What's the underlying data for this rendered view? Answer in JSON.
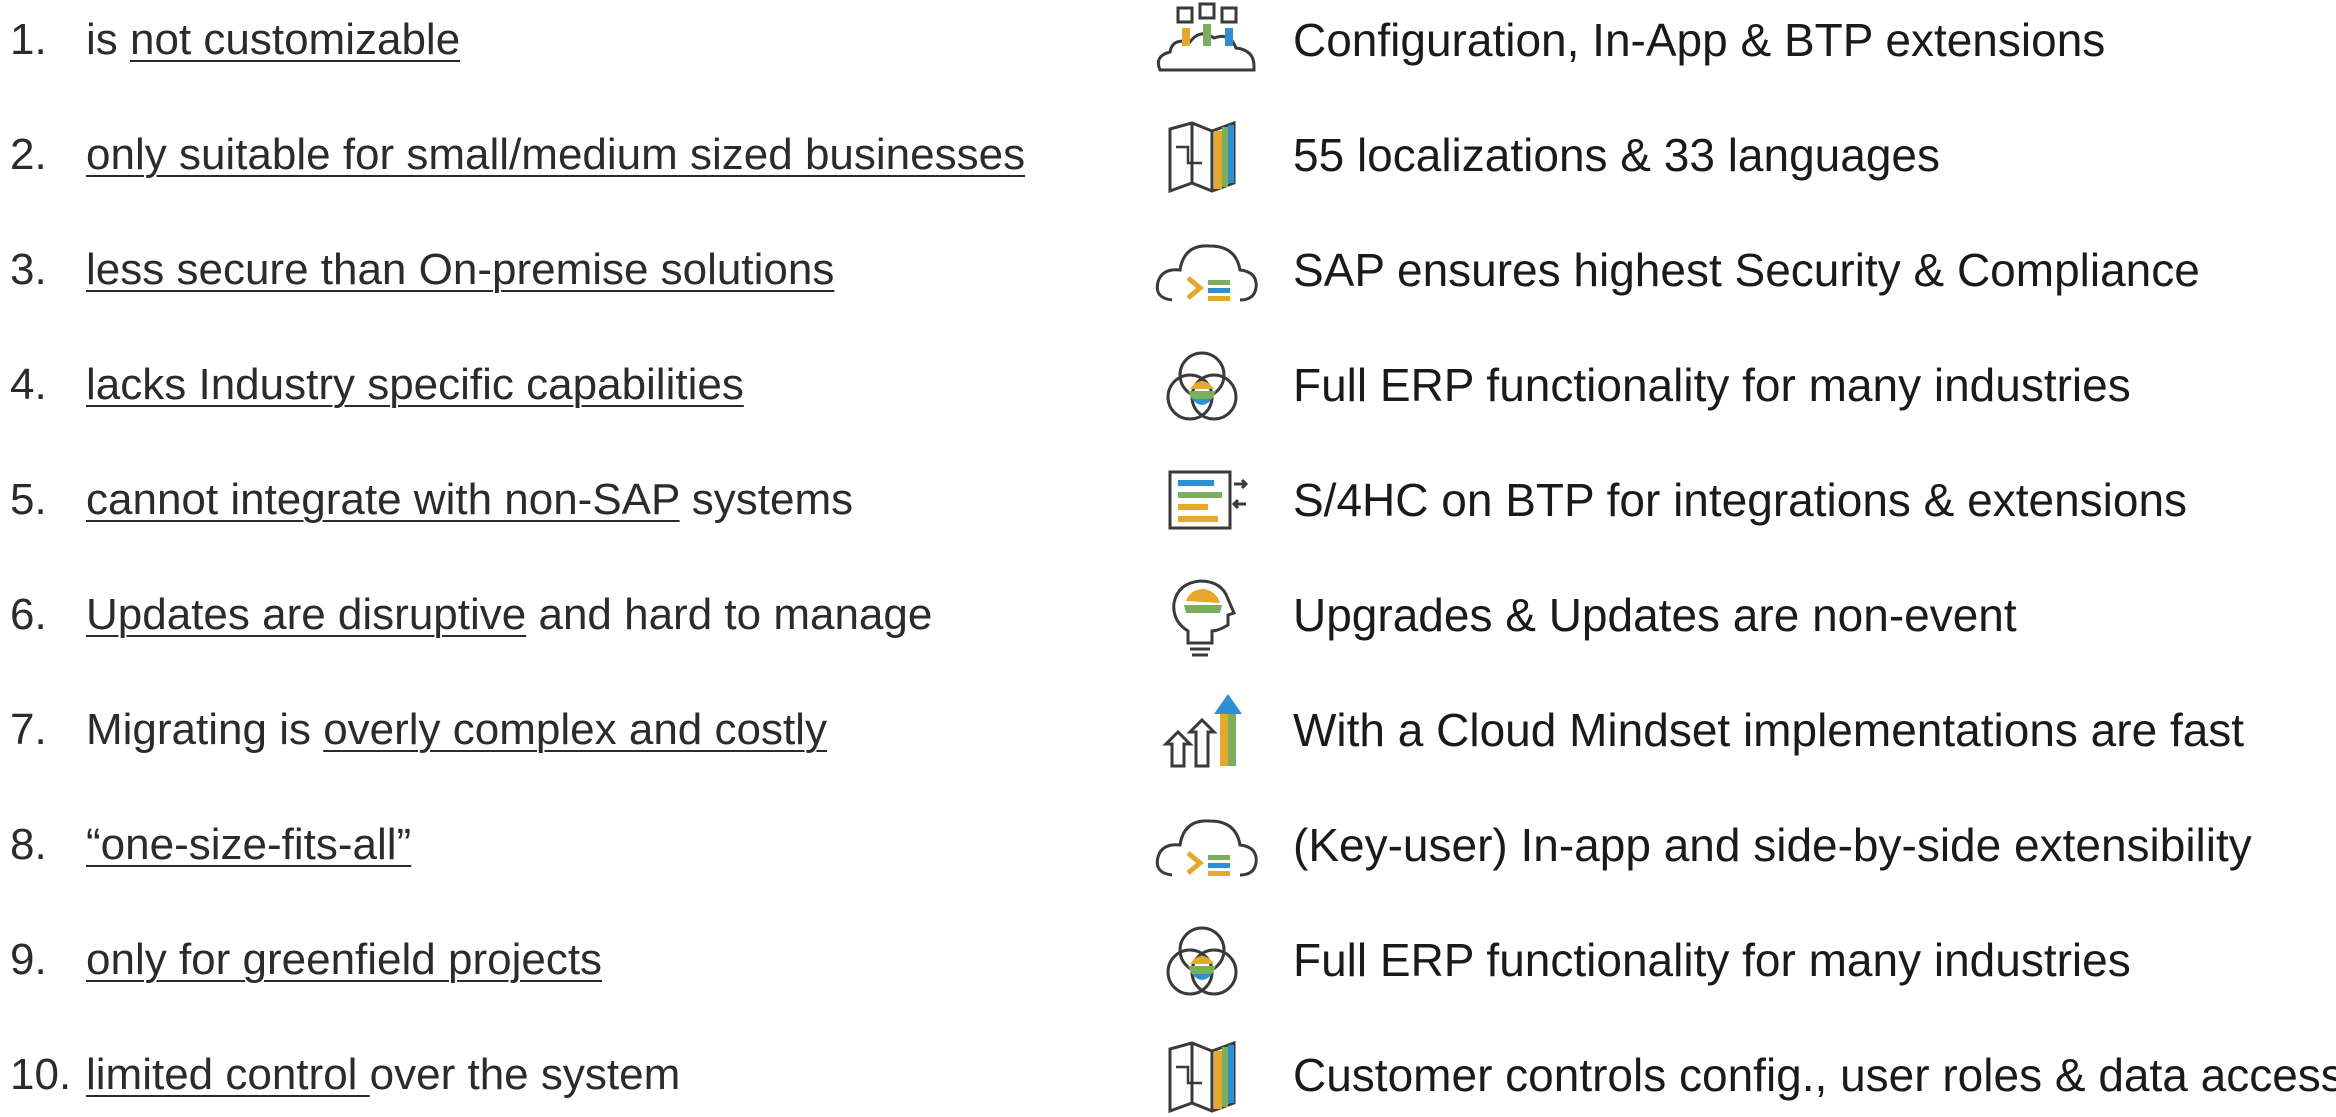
{
  "myths": [
    {
      "number": "1.",
      "parts": [
        {
          "t": "is ",
          "u": false
        },
        {
          "t": "not customizable",
          "u": true
        }
      ],
      "fact": "Configuration, In-App & BTP extensions",
      "icon": "cloud-apps-icon"
    },
    {
      "number": "2.",
      "parts": [
        {
          "t": "only suitable for small/medium sized businesses",
          "u": true
        }
      ],
      "fact": "55 localizations & 33 languages",
      "icon": "localization-map-icon"
    },
    {
      "number": "3.",
      "parts": [
        {
          "t": "less secure than On-premise solutions",
          "u": true
        }
      ],
      "fact": "SAP ensures highest Security & Compliance",
      "icon": "cloud-command-icon"
    },
    {
      "number": "4.",
      "parts": [
        {
          "t": "lacks Industry specific capabilities",
          "u": true
        }
      ],
      "fact": "Full ERP functionality for many industries",
      "icon": "venn-diagram-icon"
    },
    {
      "number": "5.",
      "parts": [
        {
          "t": "cannot integrate with non-SAP",
          "u": true
        },
        {
          "t": " systems",
          "u": false
        }
      ],
      "fact": "S/4HC on BTP for integrations & extensions",
      "icon": "integration-list-icon"
    },
    {
      "number": "6.",
      "parts": [
        {
          "t": "Updates are disruptive",
          "u": true
        },
        {
          "t": " and hard to manage",
          "u": false
        }
      ],
      "fact": "Upgrades & Updates are non-event",
      "icon": "lightbulb-head-icon"
    },
    {
      "number": "7.",
      "parts": [
        {
          "t": "Migrating is ",
          "u": false
        },
        {
          "t": "overly complex and costly",
          "u": true
        }
      ],
      "fact": "With a Cloud Mindset implementations are fast",
      "icon": "growth-arrows-icon"
    },
    {
      "number": "8.",
      "parts": [
        {
          "t": "“one-size-fits-all”",
          "u": true
        }
      ],
      "fact": "(Key-user) In-app and side-by-side extensibility",
      "icon": "cloud-command-icon"
    },
    {
      "number": "9.",
      "parts": [
        {
          "t": "only for greenfield projects",
          "u": true
        }
      ],
      "fact": "Full ERP functionality for many industries",
      "icon": "venn-diagram-icon"
    },
    {
      "number": "10.",
      "parts": [
        {
          "t": "limited control ",
          "u": true
        },
        {
          "t": "over the system",
          "u": false
        }
      ],
      "fact": "Customer controls config., user roles & data access",
      "icon": "localization-map-icon"
    }
  ],
  "colors": {
    "gold": "#e3a82c",
    "green": "#7aae5d",
    "blue": "#2f8fd0",
    "ink": "#3a3a3a"
  }
}
